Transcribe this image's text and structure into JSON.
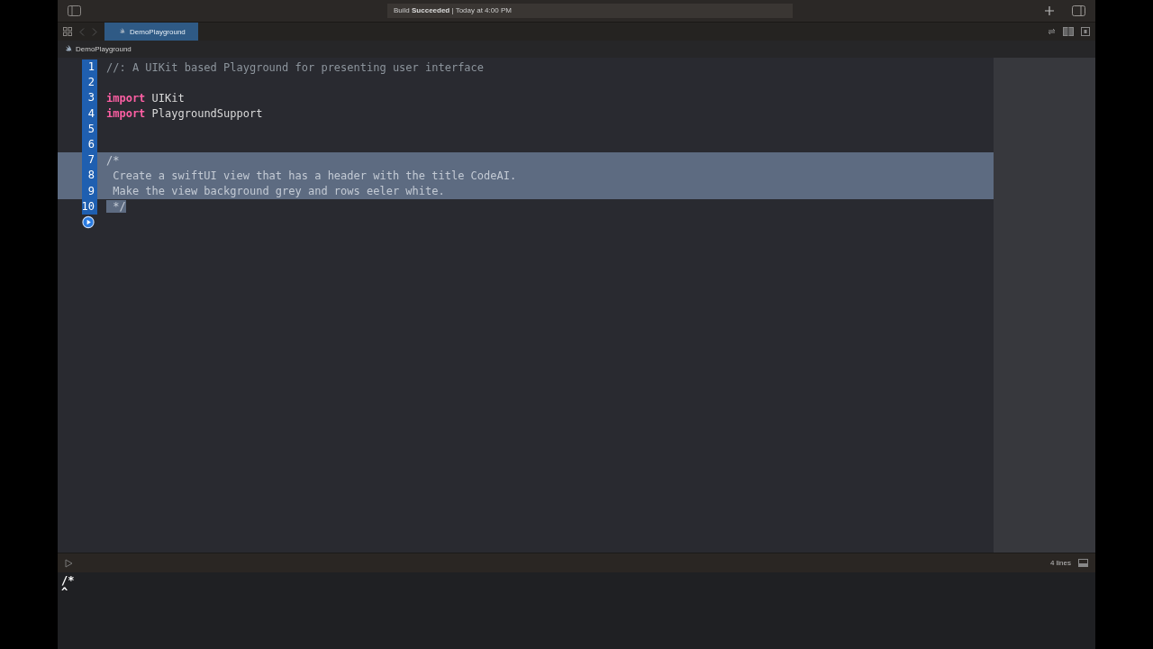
{
  "toolbar": {
    "status_prefix": "Build",
    "status_bold": "Succeeded",
    "status_suffix": "| Today at 4:00 PM"
  },
  "tabs": [
    {
      "label": "DemoPlayground",
      "selected": true
    }
  ],
  "breadcrumb": "DemoPlayground",
  "lines": [
    {
      "number": "1",
      "highlighted": true,
      "kind": "comment",
      "text": "//: A UIKit based Playground for presenting user interface",
      "selected": false
    },
    {
      "number": "2",
      "highlighted": true,
      "kind": "blank",
      "selected": false
    },
    {
      "number": "3",
      "highlighted": true,
      "kind": "import",
      "keyword": "import",
      "text": "UIKit",
      "selected": false
    },
    {
      "number": "4",
      "highlighted": true,
      "kind": "import",
      "keyword": "import",
      "text": "PlaygroundSupport",
      "selected": false
    },
    {
      "number": "5",
      "highlighted": true,
      "kind": "blank",
      "selected": false
    },
    {
      "number": "6",
      "highlighted": true,
      "kind": "blank",
      "selected": false
    },
    {
      "number": "7",
      "highlighted": true,
      "kind": "comment",
      "text": "/*",
      "selected": true
    },
    {
      "number": "8",
      "highlighted": true,
      "kind": "comment",
      "text": " Create a swiftUI view that has a header with the title CodeAI.",
      "selected": true
    },
    {
      "number": "9",
      "highlighted": true,
      "kind": "comment",
      "text": " Make the view background grey and rows eeler white.",
      "selected": true
    },
    {
      "number": "10",
      "highlighted": true,
      "kind": "comment",
      "text": " */",
      "selected": true
    }
  ],
  "run_marker": true,
  "debug_bar": {
    "line_count": "4 lines"
  },
  "console": [
    "/*",
    "^"
  ]
}
